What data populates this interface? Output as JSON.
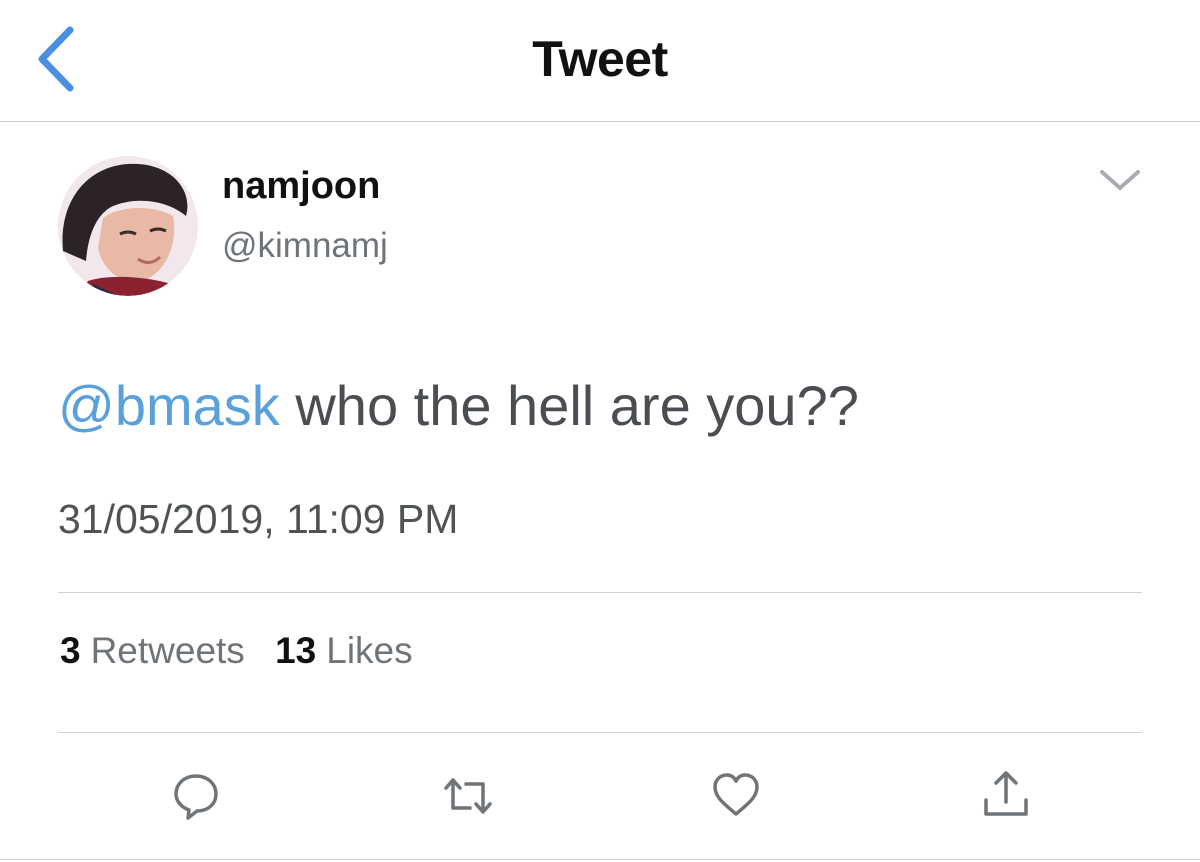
{
  "nav": {
    "title": "Tweet",
    "back_icon": "chevron-left-icon"
  },
  "author": {
    "name": "namjoon",
    "handle": "@kimnamj"
  },
  "tweet": {
    "mention": "@bmask",
    "text": " who the hell are you??",
    "timestamp": "31/05/2019, 11:09 PM"
  },
  "stats": {
    "retweets_count": "3",
    "retweets_label": "Retweets",
    "likes_count": "13",
    "likes_label": "Likes"
  },
  "actions": [
    {
      "icon": "reply-icon"
    },
    {
      "icon": "retweet-icon"
    },
    {
      "icon": "heart-icon"
    },
    {
      "icon": "share-icon"
    }
  ],
  "colors": {
    "accent": "#4a90e2",
    "mention": "#5aa1dc",
    "icon_gray": "#6f7479",
    "divider": "#cfd3d6"
  }
}
